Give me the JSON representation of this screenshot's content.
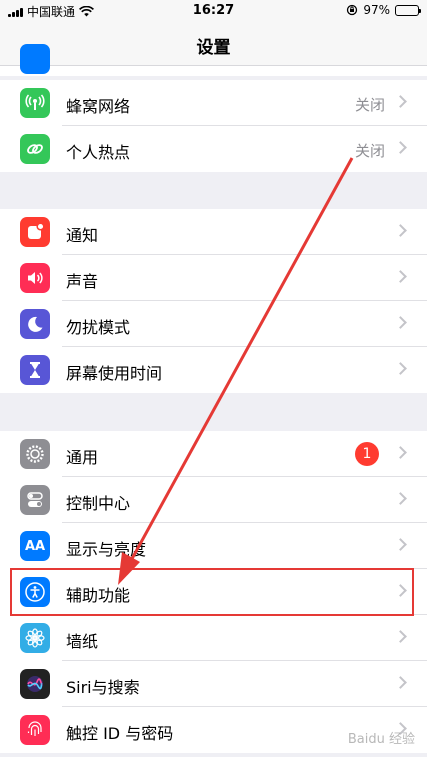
{
  "status_bar": {
    "carrier": "中国联通",
    "time": "16:27",
    "battery": "97%",
    "battery_level": 0.97
  },
  "nav": {
    "title": "设置"
  },
  "group1": [
    {
      "label": "蜂窝网络",
      "value": "关闭",
      "icon": "cellular-icon",
      "color": "#34c759"
    },
    {
      "label": "个人热点",
      "value": "关闭",
      "icon": "hotspot-icon",
      "color": "#34c759"
    }
  ],
  "group2": [
    {
      "label": "通知",
      "icon": "notifications-icon",
      "color": "#ff3b30"
    },
    {
      "label": "声音",
      "icon": "speaker-icon",
      "color": "#ff2d55"
    },
    {
      "label": "勿扰模式",
      "icon": "moon-icon",
      "color": "#5856d6"
    },
    {
      "label": "屏幕使用时间",
      "icon": "hourglass-icon",
      "color": "#5856d6"
    }
  ],
  "group3": [
    {
      "label": "通用",
      "badge": "1",
      "icon": "gear-icon",
      "color": "#8e8e93"
    },
    {
      "label": "控制中心",
      "icon": "toggle-icon",
      "color": "#8e8e93"
    },
    {
      "label": "显示与亮度",
      "icon": "display-icon",
      "icon_text": "AA",
      "color": "#007aff"
    },
    {
      "label": "辅助功能",
      "icon": "accessibility-icon",
      "color": "#007aff"
    },
    {
      "label": "墙纸",
      "icon": "flower-icon",
      "color": "#32ade6"
    },
    {
      "label": "Siri与搜索",
      "icon": "siri-icon",
      "color": "#222222"
    },
    {
      "label": "触控 ID 与密码",
      "icon": "fingerprint-icon",
      "color": "#ff2d55"
    }
  ],
  "watermark": "Baidu 经验"
}
